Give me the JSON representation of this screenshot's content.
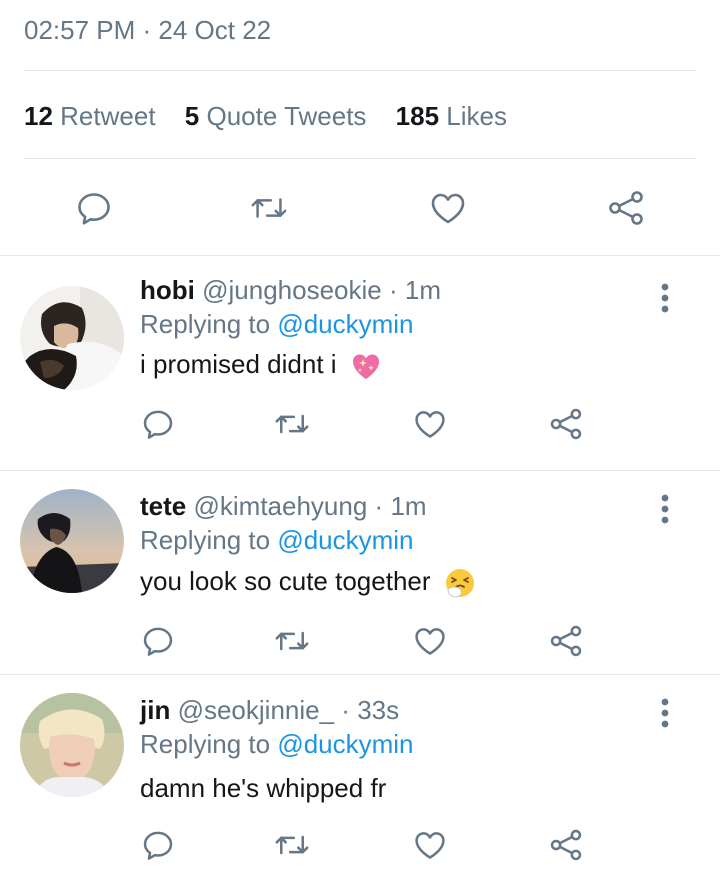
{
  "tweet": {
    "timestamp": "02:57 PM · 24 Oct 22",
    "stats": [
      {
        "count": "12",
        "label": "Retweet"
      },
      {
        "count": "5",
        "label": "Quote Tweets"
      },
      {
        "count": "185",
        "label": "Likes"
      }
    ],
    "actions": [
      "reply-icon",
      "retweet-icon",
      "like-icon",
      "share-icon"
    ]
  },
  "replies": [
    {
      "name": "hobi",
      "handle": "@junghoseokie",
      "time": "1m",
      "replying_prefix": "Replying to",
      "replying_to": "@duckymin",
      "text": "i promised didnt i",
      "emoji": "sparkling-heart"
    },
    {
      "name": "tete",
      "handle": "@kimtaehyung",
      "time": "1m",
      "replying_prefix": "Replying to",
      "replying_to": "@duckymin",
      "text": "you look so cute together",
      "emoji": "sneezing-face"
    },
    {
      "name": "jin",
      "handle": "@seokjinnie_",
      "time": "33s",
      "replying_prefix": "Replying to",
      "replying_to": "@duckymin",
      "text": "damn he's whipped fr",
      "emoji": ""
    }
  ],
  "colors": {
    "text": "#14171a",
    "secondary": "#657786",
    "link": "#1b95e0",
    "divider": "#e1e8ed"
  }
}
